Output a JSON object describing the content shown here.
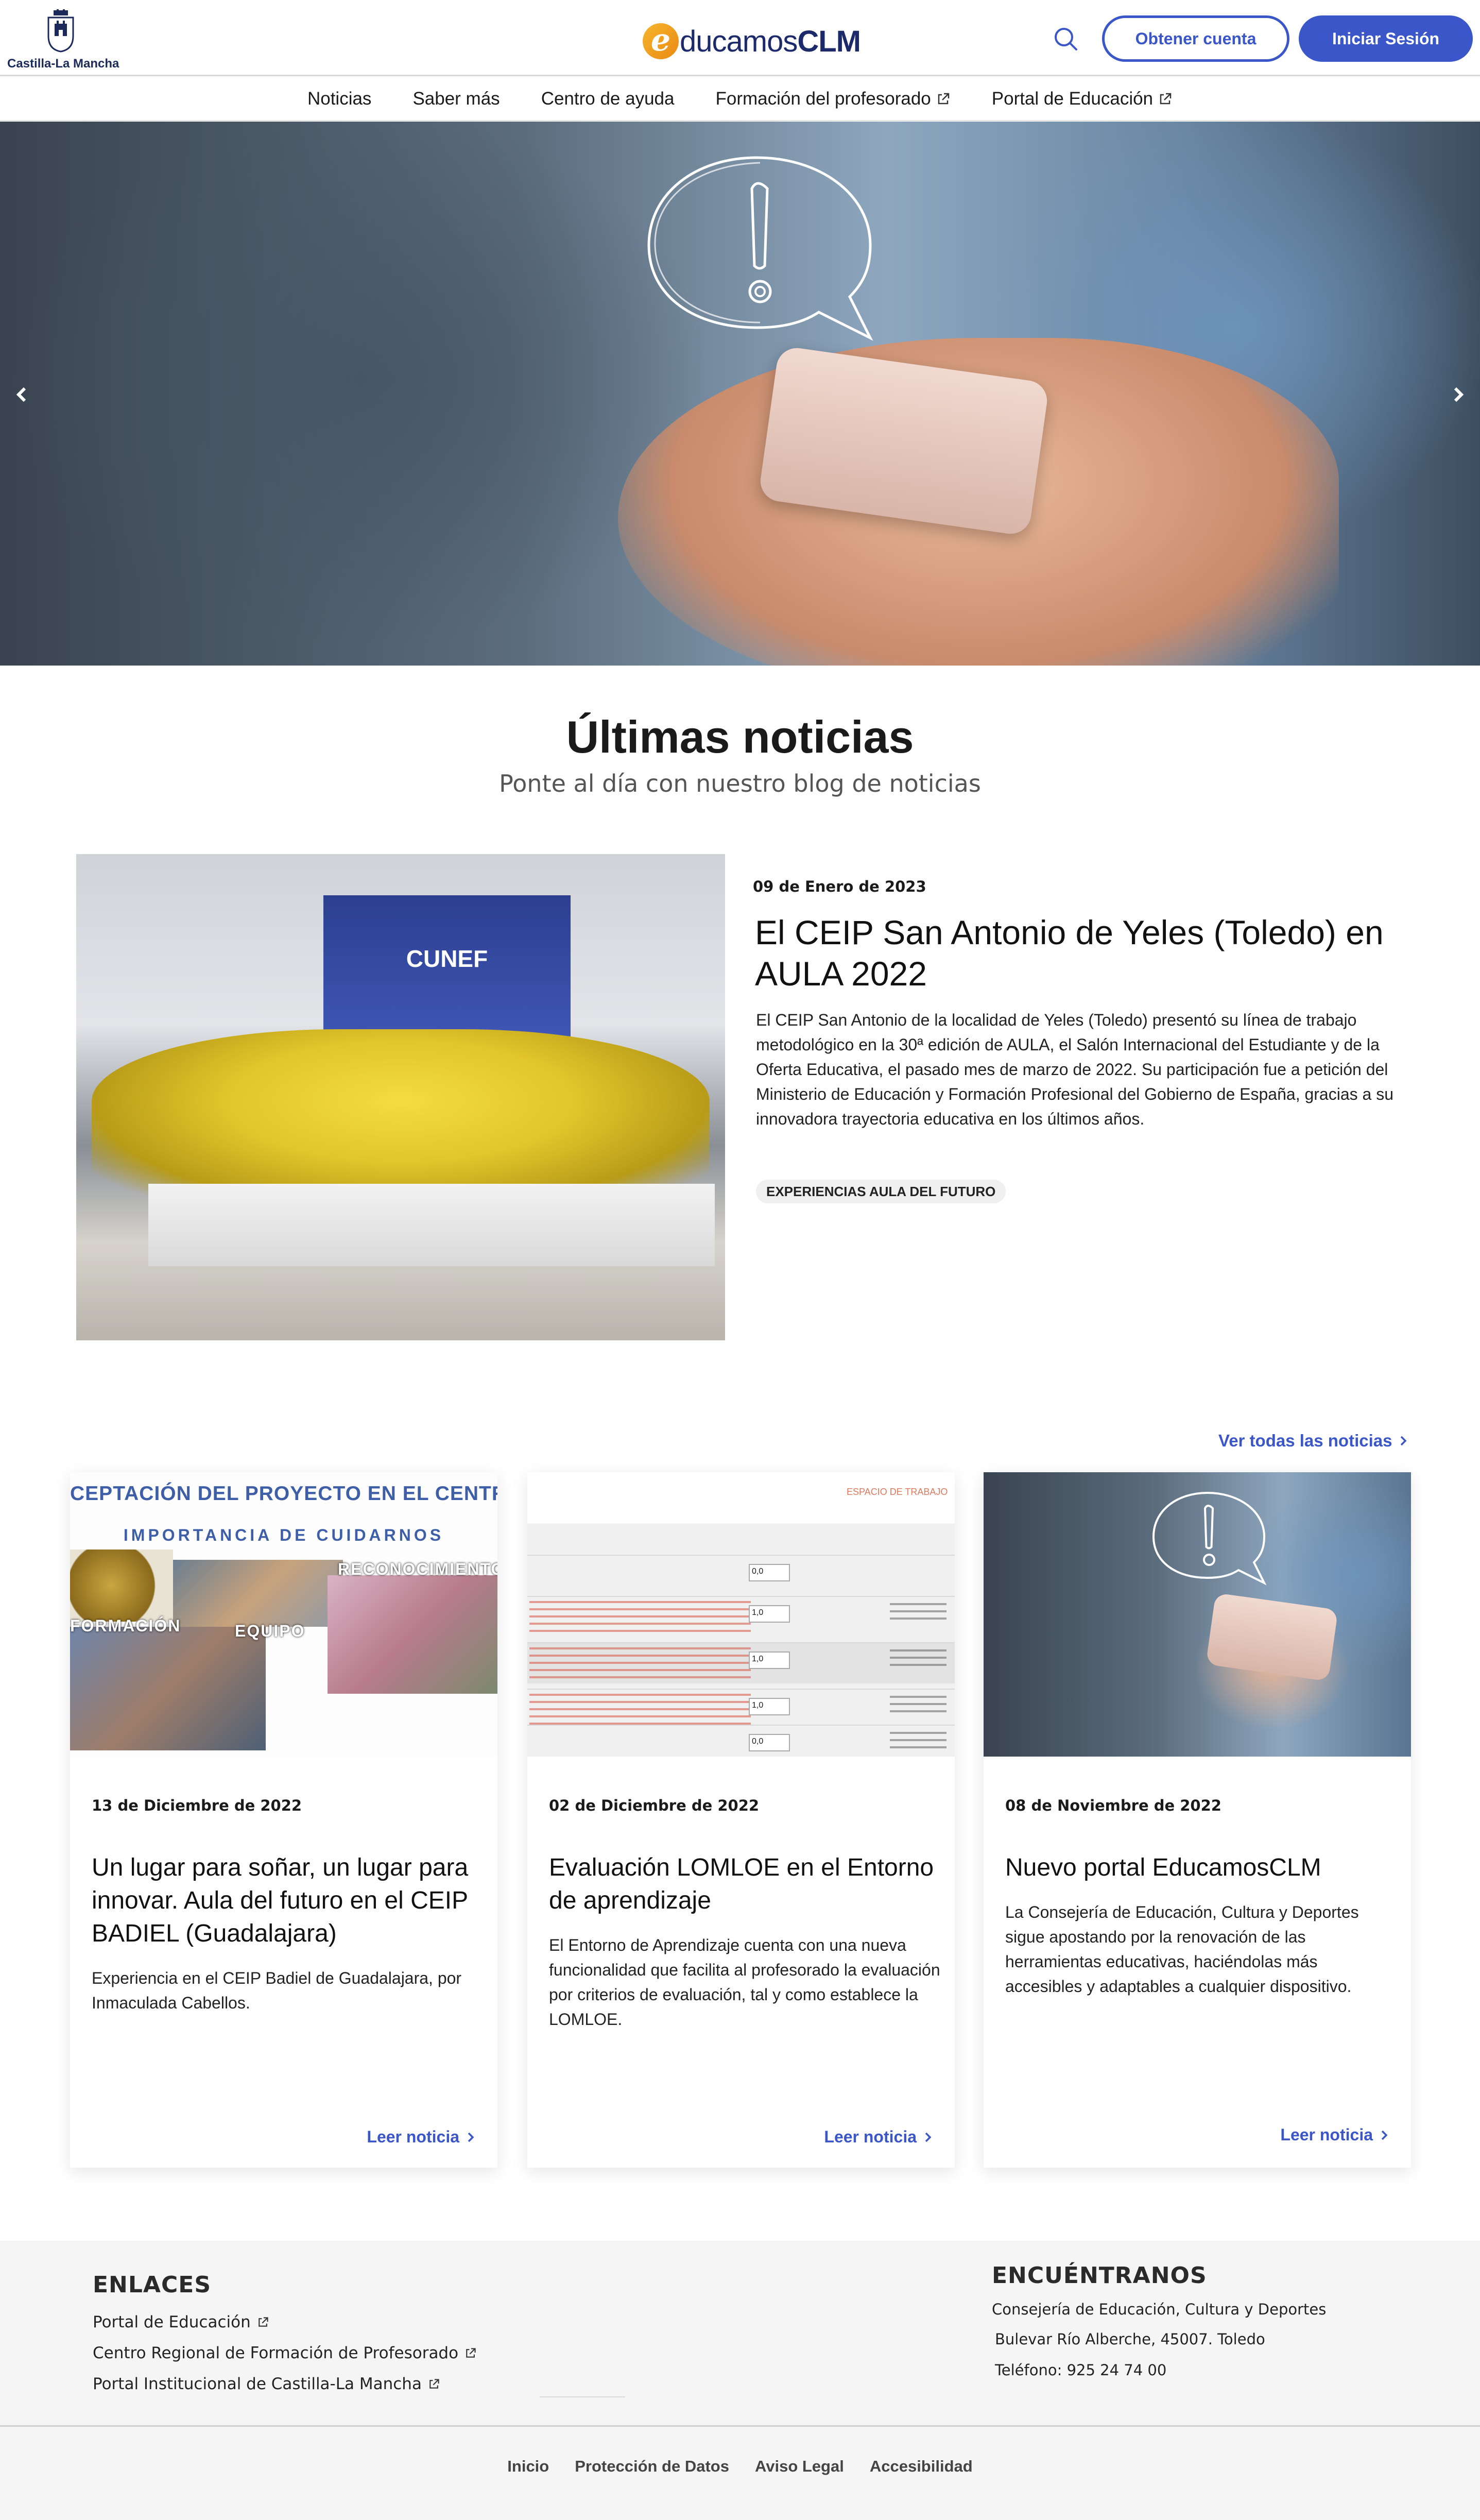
{
  "header": {
    "logo_text": "Castilla-La Mancha",
    "brand_e": "e",
    "brand_mid": "ducamos",
    "brand_bold": "CLM",
    "register_label": "Obtener cuenta",
    "login_label": "Iniciar Sesión",
    "accent_color": "#3a56c8"
  },
  "nav": {
    "items": [
      {
        "label": "Noticias",
        "external": false
      },
      {
        "label": "Saber más",
        "external": false
      },
      {
        "label": "Centro de ayuda",
        "external": false
      },
      {
        "label": "Formación del profesorado",
        "external": true
      },
      {
        "label": "Portal de Educación",
        "external": true
      }
    ]
  },
  "hero": {
    "prev_icon": "chevron-left-icon",
    "next_icon": "chevron-right-icon"
  },
  "news_section": {
    "title": "Últimas noticias",
    "subtitle": "Ponte al día con nuestro blog de noticias",
    "see_all": "Ver todas las noticias"
  },
  "featured": {
    "booth_text": "CUNEF",
    "date": "09 de Enero de 2023",
    "title": "El CEIP San Antonio de Yeles (Toledo) en AULA 2022",
    "body": "El CEIP San Antonio de la localidad de Yeles (Toledo) presentó su línea de trabajo metodológico en la 30ª edición de AULA, el Salón Internacional del Estudiante y de la Oferta Educativa, el pasado mes de marzo de 2022. Su participación fue a petición del Ministerio de Educación y Formación Profesional del Gobierno de España, gracias a su innovadora trayectoria educativa en los últimos años.",
    "tag": "EXPERIENCIAS AULA DEL FUTURO"
  },
  "cards": [
    {
      "img_line1": "CEPTACIÓN DEL PROYECTO EN EL CENTRO",
      "img_line2": "IMPORTANCIA DE CUIDARNOS",
      "img_badge1": "RECONOCIMIENTO",
      "img_badge2": "FORMACIÓN",
      "img_badge3": "EQUIPO",
      "date": "13 de Diciembre de 2022",
      "title": "Un lugar para soñar, un lugar para innovar. Aula del futuro en el CEIP BADIEL (Guadalajara)",
      "body": "Experiencia en el CEIP Badiel de Guadalajara, por Inmaculada Cabellos.",
      "read": "Leer noticia"
    },
    {
      "img_header": "ESPACIO DE TRABAJO",
      "img_values": [
        "0,0",
        "1,0",
        "1,0",
        "1,0",
        "0,0"
      ],
      "date": "02 de Diciembre de 2022",
      "title": "Evaluación LOMLOE en el Entorno de aprendizaje",
      "body": "El Entorno de Aprendizaje cuenta con una nueva funcionalidad que facilita al profesorado la evaluación por criterios de evaluación, tal y como establece la LOMLOE.",
      "read": "Leer noticia"
    },
    {
      "date": "08 de Noviembre de 2022",
      "title": "Nuevo portal EducamosCLM",
      "body": "La Consejería de Educación, Cultura y Deportes sigue apostando por la renovación de las herramientas educativas, haciéndolas más accesibles y adaptables a cualquier dispositivo.",
      "read": "Leer noticia"
    }
  ],
  "footer": {
    "links_title": "ENLACES",
    "links": [
      "Portal de Educación",
      "Centro Regional de Formación de Profesorado",
      "Portal Institucional de Castilla-La Mancha"
    ],
    "contact_title": "ENCUÉNTRANOS",
    "contact_org": "Consejería de Educación, Cultura y Deportes",
    "contact_address": "Bulevar Río Alberche, 45007. Toledo",
    "contact_phone": "Teléfono: 925 24 74 00",
    "bottom": [
      "Inicio",
      "Protección de Datos",
      "Aviso Legal",
      "Accesibilidad"
    ]
  }
}
